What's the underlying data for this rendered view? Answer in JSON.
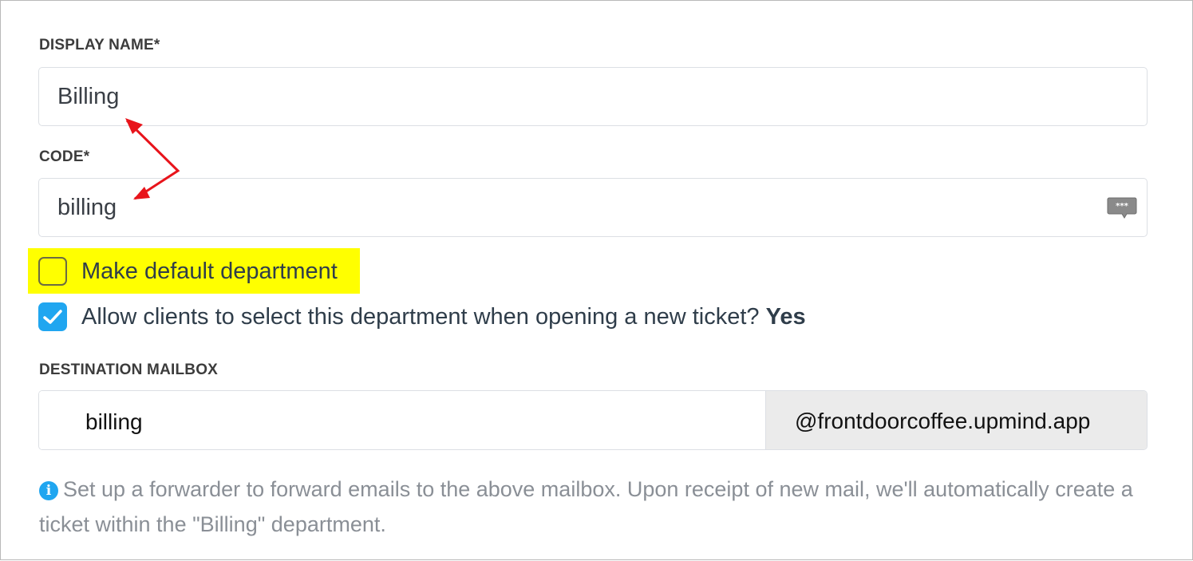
{
  "display_name": {
    "label": "DISPLAY NAME*",
    "value": "Billing"
  },
  "code": {
    "label": "CODE*",
    "value": "billing",
    "icon": "speech-bubble-icon"
  },
  "default_department": {
    "label": "Make default department",
    "checked": false
  },
  "allow_clients": {
    "label": "Allow clients to select this department when opening a new ticket?",
    "state": "Yes",
    "checked": true
  },
  "destination_mailbox": {
    "label": "DESTINATION MAILBOX",
    "local_part": "billing",
    "domain": "@frontdoorcoffee.upmind.app"
  },
  "help": {
    "icon": "info-icon",
    "text": "Set up a forwarder to forward emails to the above mailbox. Upon receipt of new mail, we'll automatically create a ticket within the \"Billing\" department."
  },
  "colors": {
    "accent": "#20a6f0",
    "highlight": "#ffff00",
    "annotation_arrow": "#e8141b"
  }
}
